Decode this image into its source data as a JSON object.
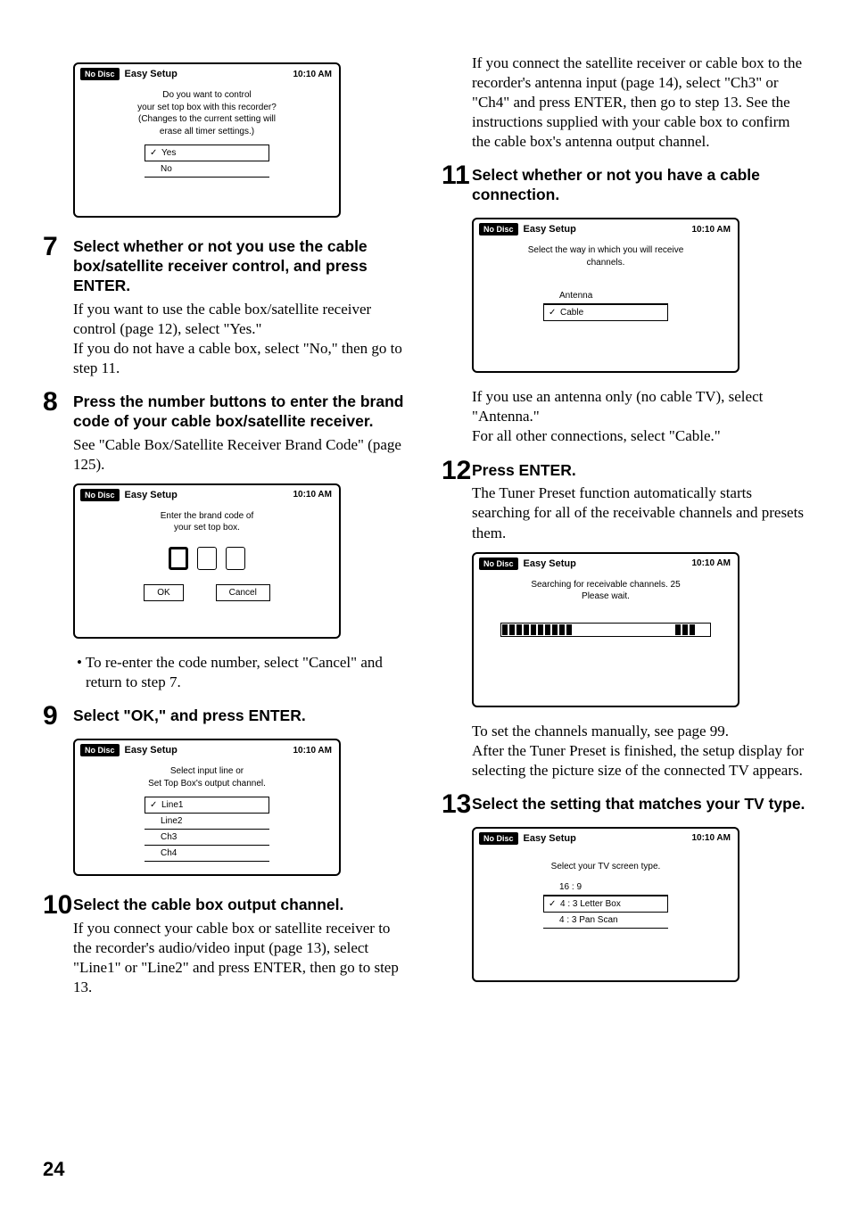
{
  "page_number": "24",
  "osd_common": {
    "chip": "No Disc",
    "title": "Easy Setup",
    "time": "10:10 AM"
  },
  "left": {
    "osd1": {
      "prompt_l1": "Do you want to control",
      "prompt_l2": "your set top box with this recorder?",
      "prompt_l3": "(Changes to the current setting will",
      "prompt_l4": "erase all timer settings.)",
      "opt_yes": "Yes",
      "opt_no": "No"
    },
    "s7": {
      "head": "Select whether or not you use the cable box/satellite receiver control, and press ENTER.",
      "p1": "If you want to use the cable box/satellite receiver control (page 12), select \"Yes.\"",
      "p2": "If you do not have a cable box, select \"No,\" then go to step 11."
    },
    "s8": {
      "head": "Press the number buttons to enter the brand code of your cable box/satellite receiver.",
      "p1": "See \"Cable Box/Satellite Receiver Brand Code\" (page 125)."
    },
    "osd2": {
      "prompt_l1": "Enter the brand code of",
      "prompt_l2": "your set top box.",
      "btn_ok": "OK",
      "btn_cancel": "Cancel"
    },
    "bullet_8": "To re-enter the code number, select \"Cancel\" and return to step 7.",
    "s9": {
      "head": "Select \"OK,\" and press ENTER."
    },
    "osd3": {
      "prompt_l1": "Select input line or",
      "prompt_l2": "Set Top Box's output channel.",
      "opt1": "Line1",
      "opt2": "Line2",
      "opt3": "Ch3",
      "opt4": "Ch4"
    },
    "s10": {
      "head": "Select the cable box output channel.",
      "p1": "If you connect your cable box or satellite receiver to the recorder's audio/video input (page 13), select \"Line1\" or \"Line2\" and press ENTER, then go to step 13."
    }
  },
  "right": {
    "cont_p": "If you connect the satellite receiver or cable box to the recorder's antenna input (page 14), select \"Ch3\" or \"Ch4\" and press ENTER, then go to step 13. See the instructions supplied with your cable box to confirm the cable box's antenna output channel.",
    "s11": {
      "head": "Select whether or not you have a cable connection."
    },
    "osd4": {
      "prompt_l1": "Select the way in which you will receive",
      "prompt_l2": "channels.",
      "opt1": "Antenna",
      "opt2": "Cable"
    },
    "s11b_p1": "If you use an antenna only (no cable TV), select \"Antenna.\"",
    "s11b_p2": "For all other connections, select \"Cable.\"",
    "s12": {
      "head": "Press ENTER.",
      "p1": "The Tuner Preset function automatically starts searching for all of the receivable channels and presets them."
    },
    "osd5": {
      "prompt_l1": "Searching for receivable channels. 25",
      "prompt_l2": "Please wait."
    },
    "s12b_p1": "To set the channels manually, see page 99.",
    "s12b_p2": "After the Tuner Preset is finished, the setup display for selecting the picture size of the connected TV appears.",
    "s13": {
      "head": "Select the setting that matches your TV type."
    },
    "osd6": {
      "prompt_l1": "Select your TV screen type.",
      "opt1": "16 : 9",
      "opt2": "4 : 3  Letter Box",
      "opt3": "4 : 3  Pan Scan"
    }
  }
}
